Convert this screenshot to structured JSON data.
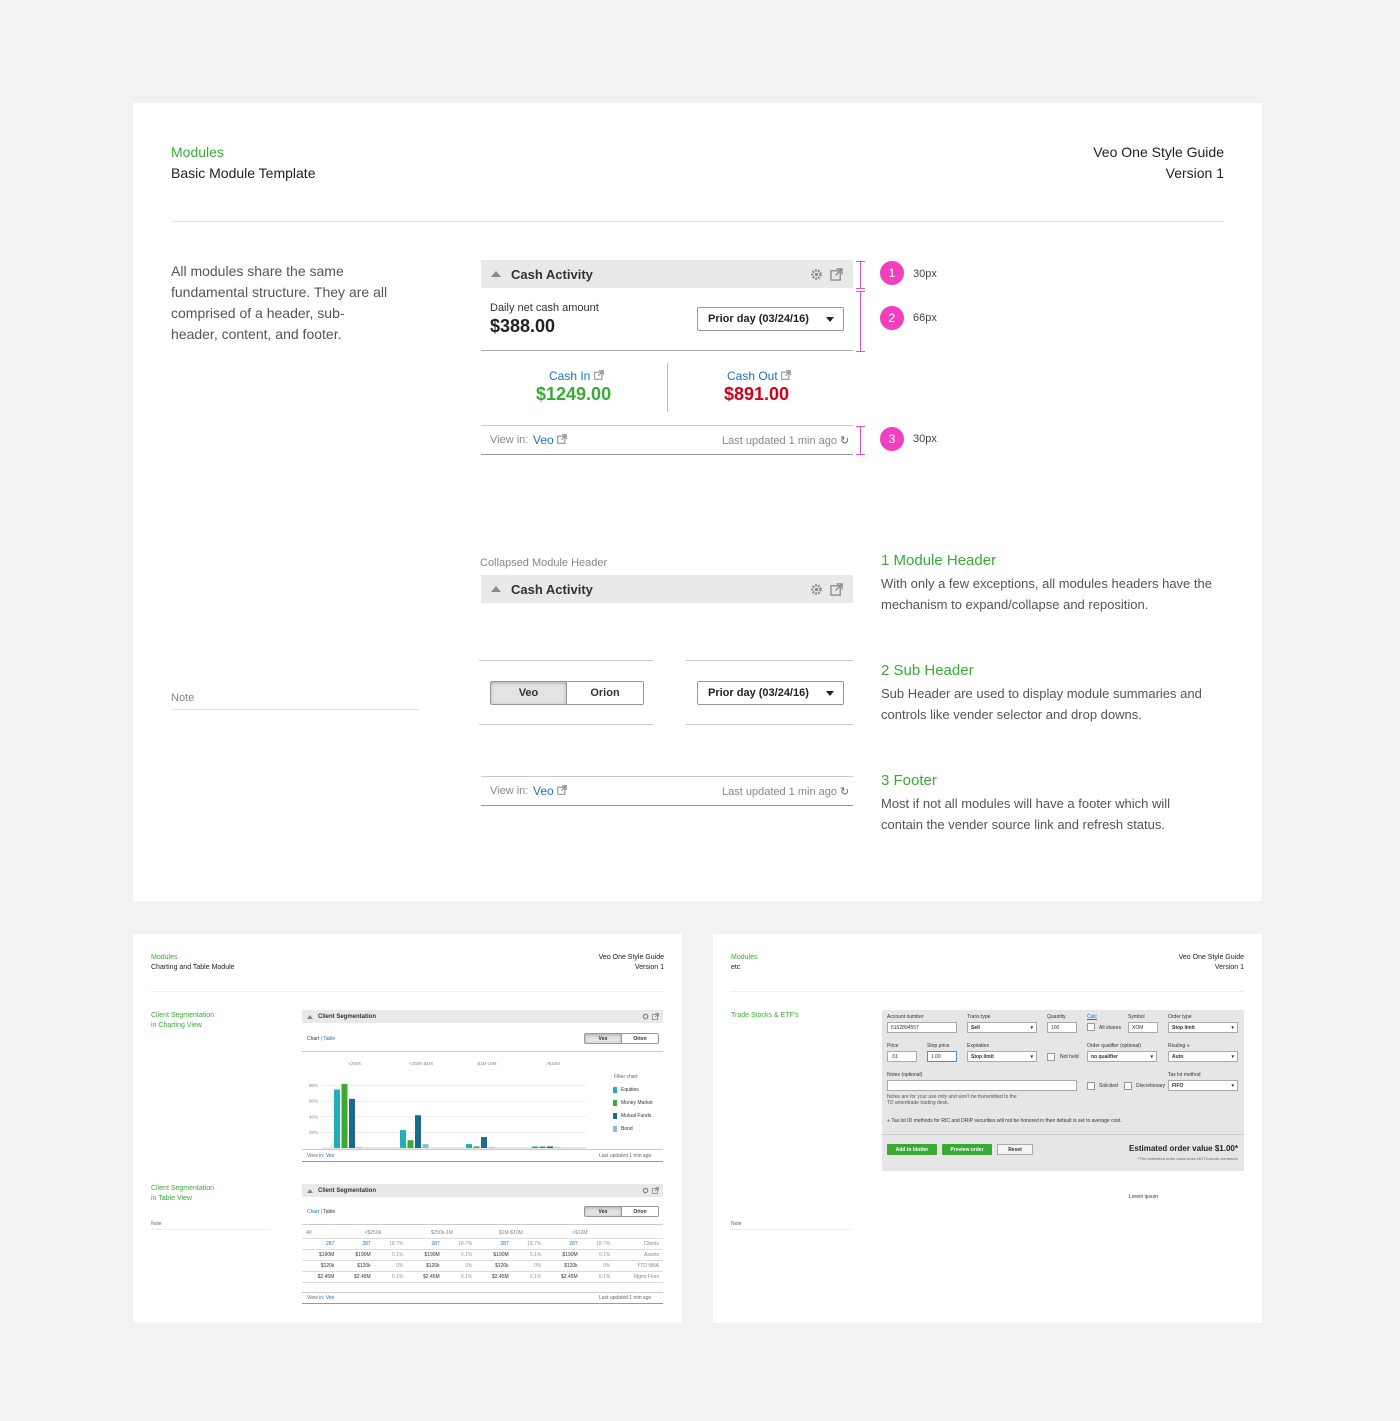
{
  "main": {
    "section": "Modules",
    "subtitle": "Basic Module Template",
    "guide_title": "Veo One Style Guide",
    "version": "Version 1",
    "intro": "All modules share the same fundamental structure. They are all comprised of a header, sub-header, content, and footer.",
    "note": "Note",
    "module": {
      "title": "Cash Activity",
      "sub_label": "Daily net cash amount",
      "sub_value": "$388.00",
      "dropdown": "Prior day (03/24/16)",
      "cash_in_label": "Cash In",
      "cash_in_value": "$1249.00",
      "cash_out_label": "Cash Out",
      "cash_out_value": "$891.00",
      "view_in": "View in:",
      "veo_link": "Veo",
      "last_updated": "Last updated 1 min ago"
    },
    "annotations": [
      {
        "num": "1",
        "size": "30px"
      },
      {
        "num": "2",
        "size": "66px"
      },
      {
        "num": "3",
        "size": "30px"
      }
    ],
    "collapsed_label": "Collapsed Module Header",
    "collapsed_title": "Cash Activity",
    "segment": {
      "left": "Veo",
      "right": "Orion"
    },
    "sub_dropdown": "Prior day (03/24/16)",
    "footer_view_in": "View in:",
    "footer_veo": "Veo",
    "footer_updated": "Last updated 1 min ago",
    "sections": [
      {
        "title": "1 Module Header",
        "body": "With only a few exceptions, all modules headers have the mechanism to expand/collapse and reposition."
      },
      {
        "title": "2 Sub Header",
        "body": "Sub Header are used to display module summaries and controls like vender selector and drop downs."
      },
      {
        "title": "3 Footer",
        "body": "Most if not all modules will have a footer which will contain the vender source link and refresh status."
      }
    ]
  },
  "chart_card": {
    "section": "Modules",
    "subtitle": "Charting and Table Module",
    "guide_title": "Veo One Style Guide",
    "version": "Version 1",
    "label1a": "Client Segmentation",
    "label1b": "in Charting View",
    "label2a": "Client Segmentation",
    "label2b": "in Table View",
    "note": "Note",
    "module_title": "Client Segmentation",
    "tab_chart": "Chart",
    "tab_table": "Table",
    "seg_left": "Veo",
    "seg_right": "Orion",
    "col_heads": [
      "<250K",
      "<250K-$1M",
      "$1M-10M",
      ">$10M"
    ],
    "filter_label": "Filter chart",
    "legend": [
      "Equities",
      "Money Market",
      "Mutual Funds",
      "Bond"
    ],
    "view_in": "View in:",
    "veo": "Veo",
    "updated": "Last updated 1 min ago",
    "table_heads": [
      "All",
      "<$250k",
      "$250k-1M",
      "$1M-$10M",
      ">$10M"
    ],
    "table_rows": [
      [
        "287",
        "287",
        "18.7%",
        "287",
        "18.7%",
        "287",
        "18.7%",
        "287",
        "18.7%",
        "Clients"
      ],
      [
        "$190M",
        "$190M",
        "5.1%",
        "$190M",
        "5.1%",
        "$190M",
        "5.1%",
        "$190M",
        "5.1%",
        "Assets"
      ],
      [
        "$120k",
        "$120k",
        "0%",
        "$120k",
        "0%",
        "$120k",
        "0%",
        "$120k",
        "0%",
        "YTD NNA"
      ],
      [
        "$2.45M",
        "$2.45M",
        "6.1%",
        "$2.45M",
        "6.1%",
        "$2.45M",
        "6.1%",
        "$2.45M",
        "6.1%",
        "Mgmt Fees"
      ]
    ]
  },
  "chart_data": {
    "type": "bar",
    "categories": [
      "<250K",
      "<250K-$1M",
      "$1M-10M",
      ">$10M"
    ],
    "series": [
      {
        "name": "Equities",
        "values": [
          75,
          23,
          5,
          2
        ]
      },
      {
        "name": "Money Market",
        "values": [
          82,
          10,
          2,
          2
        ]
      },
      {
        "name": "Mutual Funds",
        "values": [
          63,
          42,
          14,
          2
        ]
      },
      {
        "name": "Bond",
        "values": [
          1,
          5,
          1,
          1
        ]
      }
    ],
    "ytick_labels": [
      "20%",
      "40%",
      "60%",
      "80%"
    ],
    "ylim": [
      0,
      100
    ],
    "colors": [
      "#1fb0b5",
      "#3aaa35",
      "#1b6b8c",
      "#8cb7d8"
    ]
  },
  "trade_card": {
    "section": "Modules",
    "subtitle": "etc",
    "guide_title": "Veo One Style Guide",
    "version": "Version 1",
    "label": "Trade Stocks & ETF's",
    "note": "Note",
    "fields": {
      "account_number": "Account number",
      "account_value": "5162894557",
      "trans_type": "Trans type",
      "trans_value": "Sell",
      "quantity": "Quantity",
      "quantity_value": "100",
      "calc": "Calc",
      "all_shares": "All shares",
      "symbol": "Symbol",
      "symbol_value": "XOM",
      "order_type": "Order type",
      "order_type_value": "Stop limit",
      "price": "Price",
      "price_value": ".01",
      "stop_price": "Stop price",
      "stop_price_value": "1.00",
      "expiration": "Expiration",
      "expiration_value": "Stop limit",
      "not_held": "Not held",
      "order_qualifier": "Order qualifier (optional)",
      "order_qualifier_value": "no qualifier",
      "routing": "Routing",
      "routing_value": "Auto",
      "notes": "Notes (optional)",
      "notes_help": "Notes are for your use only and won't be transmitted to the TD ameritrade trading desk.",
      "solicited": "Solicited",
      "discretionary": "Discretionary",
      "tax_lot": "Tax lot method",
      "tax_lot_value": "FIFO",
      "info": "Tax lot ID methods for RIC and DRIP securities will not be honored in their default is set to average cost.",
      "add_blotter": "Add to blotter",
      "preview": "Preview order",
      "reset": "Reset",
      "estimated": "Estimated order value $1.00*",
      "estimated_note": "*The estimated order value does NOT include comission",
      "lorem": "Lorem ipsum"
    }
  }
}
